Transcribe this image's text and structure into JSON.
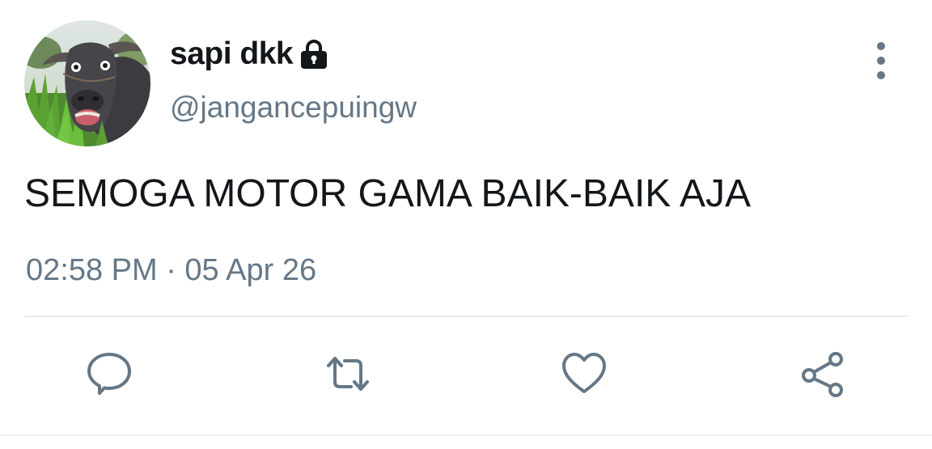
{
  "tweet": {
    "author": {
      "display_name": "sapi dkk",
      "handle": "@jangancepuingw",
      "protected": true,
      "avatar": "water-buffer-photo-avatar"
    },
    "text": "SEMOGA MOTOR GAMA BAIK-BAIK AJA",
    "timestamp": "02:58 PM · 05 Apr 26"
  },
  "actions": [
    {
      "icon": "reply-icon"
    },
    {
      "icon": "retweet-icon"
    },
    {
      "icon": "like-icon"
    },
    {
      "icon": "share-icon"
    }
  ],
  "colors": {
    "primary_text": "#14171a",
    "secondary_text": "#657786",
    "divider": "#e6ecf0",
    "background": "#ffffff"
  }
}
